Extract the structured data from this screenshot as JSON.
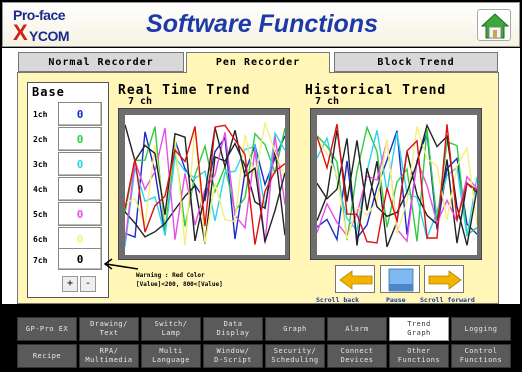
{
  "header": {
    "logo_top": "Pro-face",
    "logo_x": "X",
    "logo_rest": "YCOM",
    "title": "Software Functions"
  },
  "tabs": [
    {
      "label": "Normal Recorder"
    },
    {
      "label": "Pen Recorder"
    },
    {
      "label": "Block Trend"
    }
  ],
  "base": {
    "label": "Base",
    "channels": [
      {
        "label": "1ch",
        "value": "0",
        "color": "#1a2cc9"
      },
      {
        "label": "2ch",
        "value": "0",
        "color": "#2ecc40"
      },
      {
        "label": "3ch",
        "value": "0",
        "color": "#2fd4e6"
      },
      {
        "label": "4ch",
        "value": "0",
        "color": "#000000"
      },
      {
        "label": "5ch",
        "value": "0",
        "color": "#e64fe6"
      },
      {
        "label": "6ch",
        "value": "0",
        "color": "#f5f07a"
      },
      {
        "label": "7ch",
        "value": "0",
        "color": "#000000"
      }
    ],
    "plus": "+",
    "minus": "-"
  },
  "realtime": {
    "title": "Real Time Trend",
    "sub": "7 ch"
  },
  "historical": {
    "title": "Historical Trend",
    "sub": "7 ch"
  },
  "warning": {
    "line1": "Warning : Red Color",
    "line2": "[Value]<200, 800<[Value]"
  },
  "controls": {
    "scroll_back": "Scroll back",
    "pause": "Pause",
    "scroll_forward": "Scroll forward"
  },
  "bottom_row1": [
    "GP-Pro EX",
    "Drawing/\nText",
    "Switch/\nLamp",
    "Data\nDisplay",
    "Graph",
    "Alarm",
    "Trend\nGraph",
    "Logging"
  ],
  "bottom_row2": [
    "Recipe",
    "RPA/\nMultimedia",
    "Multi\nLanguage",
    "Window/\nD-Script",
    "Security/\nScheduling",
    "Connect\nDevices",
    "Other\nFunctions",
    "Control\nFunctions"
  ],
  "colors": {
    "panel": "#fff6b8",
    "title": "#1e3aa8",
    "arrow": "#f2b400",
    "button_dark": "#5a5a5a"
  }
}
